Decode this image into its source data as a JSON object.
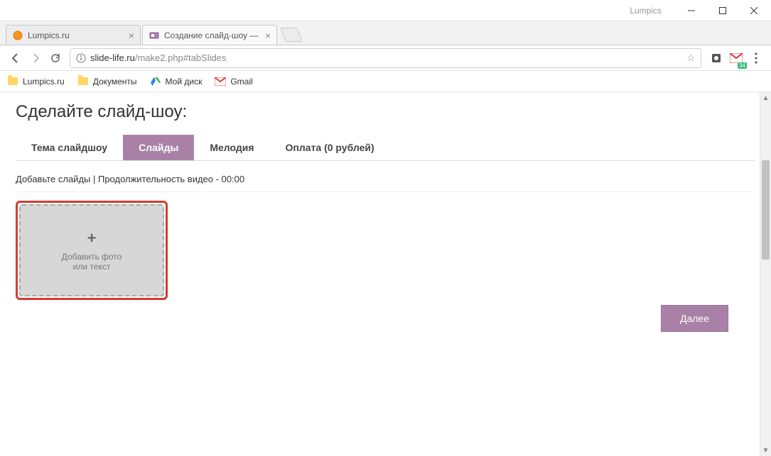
{
  "window": {
    "app_label": "Lumpics"
  },
  "browser": {
    "tabs": [
      {
        "title": "Lumpics.ru",
        "favicon": "orange-ball"
      },
      {
        "title": "Создание слайд-шоу —",
        "favicon": "slide-life"
      }
    ],
    "url_host": "slide-life.ru",
    "url_path": "/make2.php#tabSlides",
    "bookmarks": [
      {
        "label": "Lumpics.ru",
        "icon": "folder"
      },
      {
        "label": "Документы",
        "icon": "folder"
      },
      {
        "label": "Мой диск",
        "icon": "gdrive"
      },
      {
        "label": "Gmail",
        "icon": "gmail"
      }
    ],
    "gmail_badge": "34"
  },
  "page": {
    "title": "Сделайте слайд-шоу:",
    "tabs": [
      {
        "label": "Тема слайдшоу",
        "active": false
      },
      {
        "label": "Слайды",
        "active": true
      },
      {
        "label": "Мелодия",
        "active": false
      },
      {
        "label": "Оплата (0 рублей)",
        "active": false
      }
    ],
    "subhead": "Добавьте слайды | Продолжительность видео - 00:00",
    "add_slide": {
      "plus": "+",
      "line1": "Добавить фото",
      "line2": "или текст"
    },
    "next_label": "Далее"
  }
}
